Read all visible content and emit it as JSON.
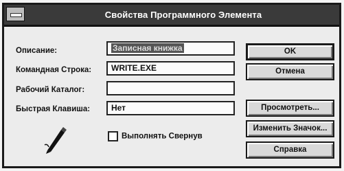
{
  "window": {
    "title": "Свойства Программного Элемента"
  },
  "fields": {
    "description_label": "Описание:",
    "description_value": "Записная книжка",
    "command_line_label": "Командная Строка:",
    "command_line_value": "WRITE.EXE",
    "working_dir_label": "Рабочий Каталог:",
    "working_dir_value": "",
    "shortcut_key_label": "Быстрая Клавиша:",
    "shortcut_key_value": "Нет"
  },
  "checkbox": {
    "run_minimized_label": "Выполнять Свернув",
    "run_minimized_checked": false
  },
  "buttons": {
    "ok": "OK",
    "cancel": "Отмена",
    "browse": "Просмотреть...",
    "change_icon": "Изменить Значок...",
    "help": "Справка"
  },
  "icons": {
    "program_icon": "pen-icon"
  }
}
